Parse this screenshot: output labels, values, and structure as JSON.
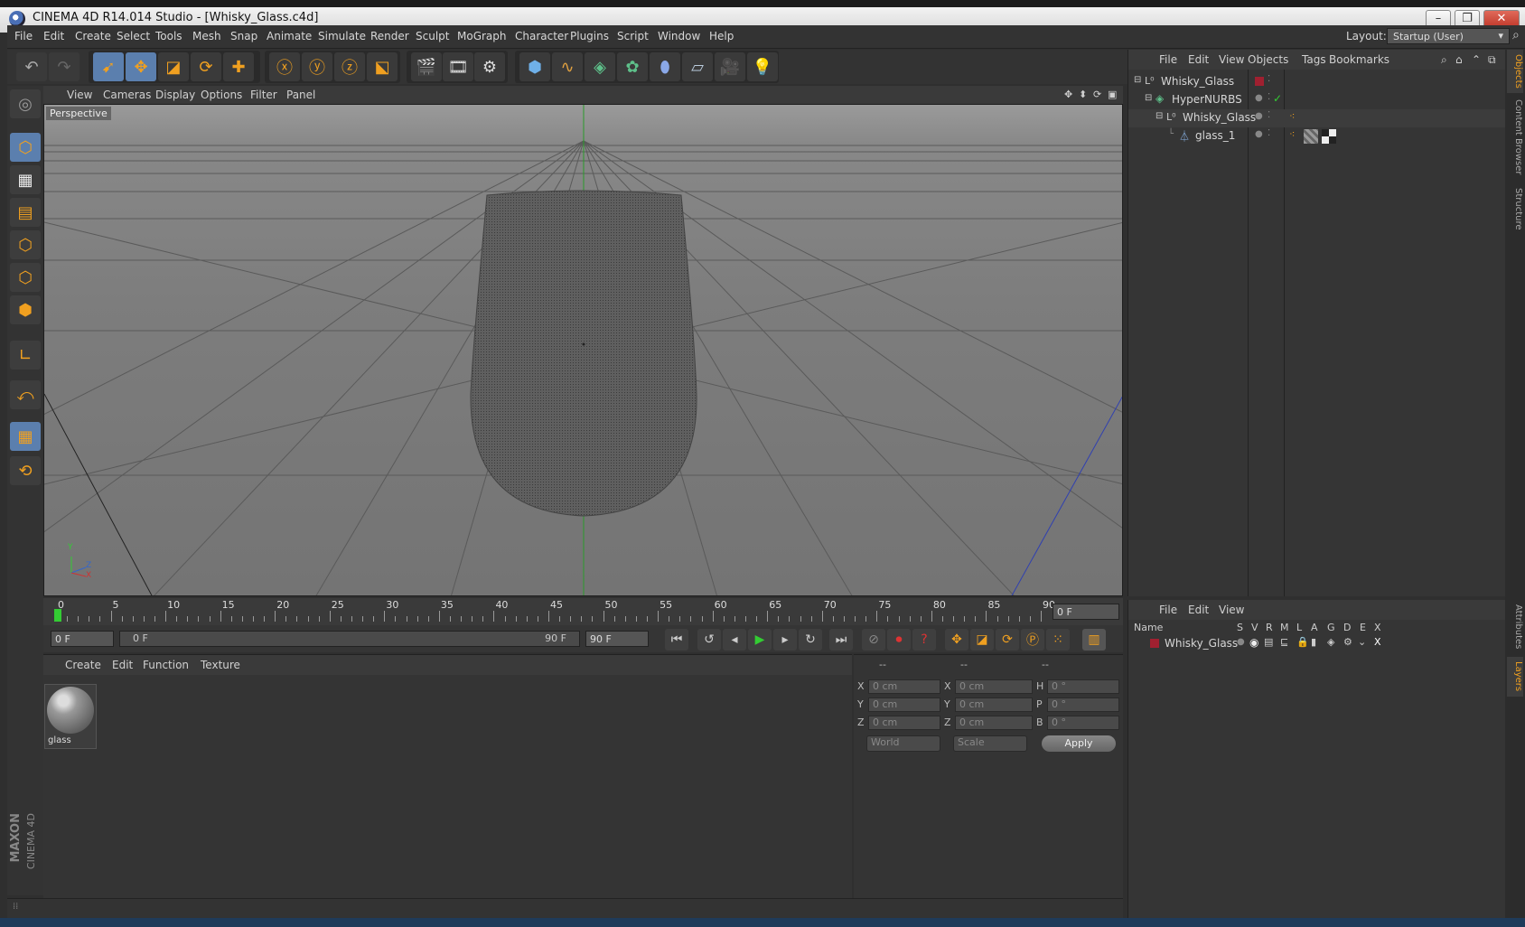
{
  "window": {
    "title": "CINEMA 4D R14.014 Studio - [Whisky_Glass.c4d]",
    "minimize": "–",
    "restore": "❐",
    "close": "✕"
  },
  "menubar": {
    "items": [
      "File",
      "Edit",
      "Create",
      "Select",
      "Tools",
      "Mesh",
      "Snap",
      "Animate",
      "Simulate",
      "Render",
      "Sculpt",
      "MoGraph",
      "Character",
      "Plugins",
      "Script",
      "Window",
      "Help"
    ],
    "layout_label": "Layout:",
    "layout_value": "Startup (User)"
  },
  "viewport": {
    "menu": [
      "View",
      "Cameras",
      "Display",
      "Options",
      "Filter",
      "Panel"
    ],
    "label": "Perspective",
    "axis_y": "Y",
    "axis_z": "Z",
    "axis_x": "X"
  },
  "timeline": {
    "ticks": [
      "0",
      "5",
      "10",
      "15",
      "20",
      "25",
      "30",
      "35",
      "40",
      "45",
      "50",
      "55",
      "60",
      "65",
      "70",
      "75",
      "80",
      "85",
      "90"
    ],
    "current_frame": "0 F",
    "start_field": "0 F",
    "range_left": "0 F",
    "range_right": "90 F",
    "end_field": "90 F"
  },
  "material_manager": {
    "menu": [
      "Create",
      "Edit",
      "Function",
      "Texture"
    ],
    "materials": [
      {
        "name": "glass"
      }
    ]
  },
  "coordinates": {
    "headers": [
      "--",
      "--",
      "--"
    ],
    "rows": [
      {
        "a": "X",
        "v1": "0 cm",
        "b": "X",
        "v2": "0 cm",
        "c": "H",
        "v3": "0 °"
      },
      {
        "a": "Y",
        "v1": "0 cm",
        "b": "Y",
        "v2": "0 cm",
        "c": "P",
        "v3": "0 °"
      },
      {
        "a": "Z",
        "v1": "0 cm",
        "b": "Z",
        "v2": "0 cm",
        "c": "B",
        "v3": "0 °"
      }
    ],
    "mode1": "World",
    "mode2": "Scale",
    "apply": "Apply"
  },
  "object_manager": {
    "menu": [
      "File",
      "Edit",
      "View",
      "Objects",
      "Tags",
      "Bookmarks"
    ],
    "objects": [
      {
        "name": "Whisky_Glass"
      },
      {
        "name": "HyperNURBS"
      },
      {
        "name": "Whisky_Glass"
      },
      {
        "name": "glass_1"
      }
    ]
  },
  "layer_manager": {
    "menu": [
      "File",
      "Edit",
      "View"
    ],
    "columns": [
      "Name",
      "S",
      "V",
      "R",
      "M",
      "L",
      "A",
      "G",
      "D",
      "E",
      "X"
    ],
    "layers": [
      {
        "name": "Whisky_Glass"
      }
    ]
  },
  "right_tabs": [
    "Objects",
    "Content Browser",
    "Structure",
    "Attributes",
    "Layers"
  ],
  "brand": {
    "line1": "MAXON",
    "line2": "CINEMA 4D"
  },
  "colors": {
    "accent": "#f0a020",
    "active_tool": "#5b7fae",
    "layer_color": "#a02030",
    "x_axis": "#c03030",
    "y_axis": "#30c030",
    "z_axis": "#3050c0"
  }
}
